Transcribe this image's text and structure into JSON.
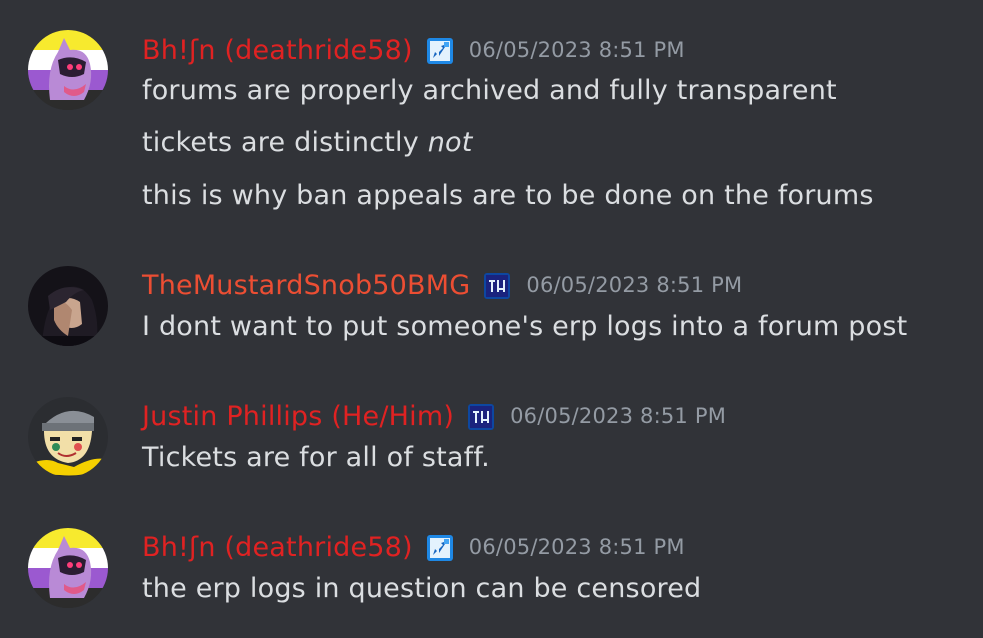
{
  "messages": [
    {
      "username": "Bh!ʃn (deathride58)",
      "role_icon": "role-badge-icon",
      "timestamp": "06/05/2023 8:51 PM",
      "lines": [
        "forums are properly archived and fully transparent",
        "tickets are distinctly ",
        "this is why ban appeals are to be done on the forums"
      ],
      "emphasis": "not"
    },
    {
      "username": "TheMustardSnob50BMG",
      "role_icon": "role-badge-icon",
      "timestamp": "06/05/2023 8:51 PM",
      "lines": [
        "I dont want to put someone's erp logs into a forum post"
      ]
    },
    {
      "username": "Justin Phillips (He/Him)",
      "role_icon": "role-badge-icon",
      "timestamp": "06/05/2023 8:51 PM",
      "lines": [
        "Tickets are for all of staff."
      ]
    },
    {
      "username": "Bh!ʃn (deathride58)",
      "role_icon": "role-badge-icon",
      "timestamp": "06/05/2023 8:51 PM",
      "lines": [
        "the erp logs in question can be censored"
      ]
    }
  ],
  "colors": {
    "background": "#313338",
    "username_red": "#e02222",
    "username_orange": "#ec4e33",
    "timestamp": "#949ba4",
    "text": "#dbdee1"
  }
}
